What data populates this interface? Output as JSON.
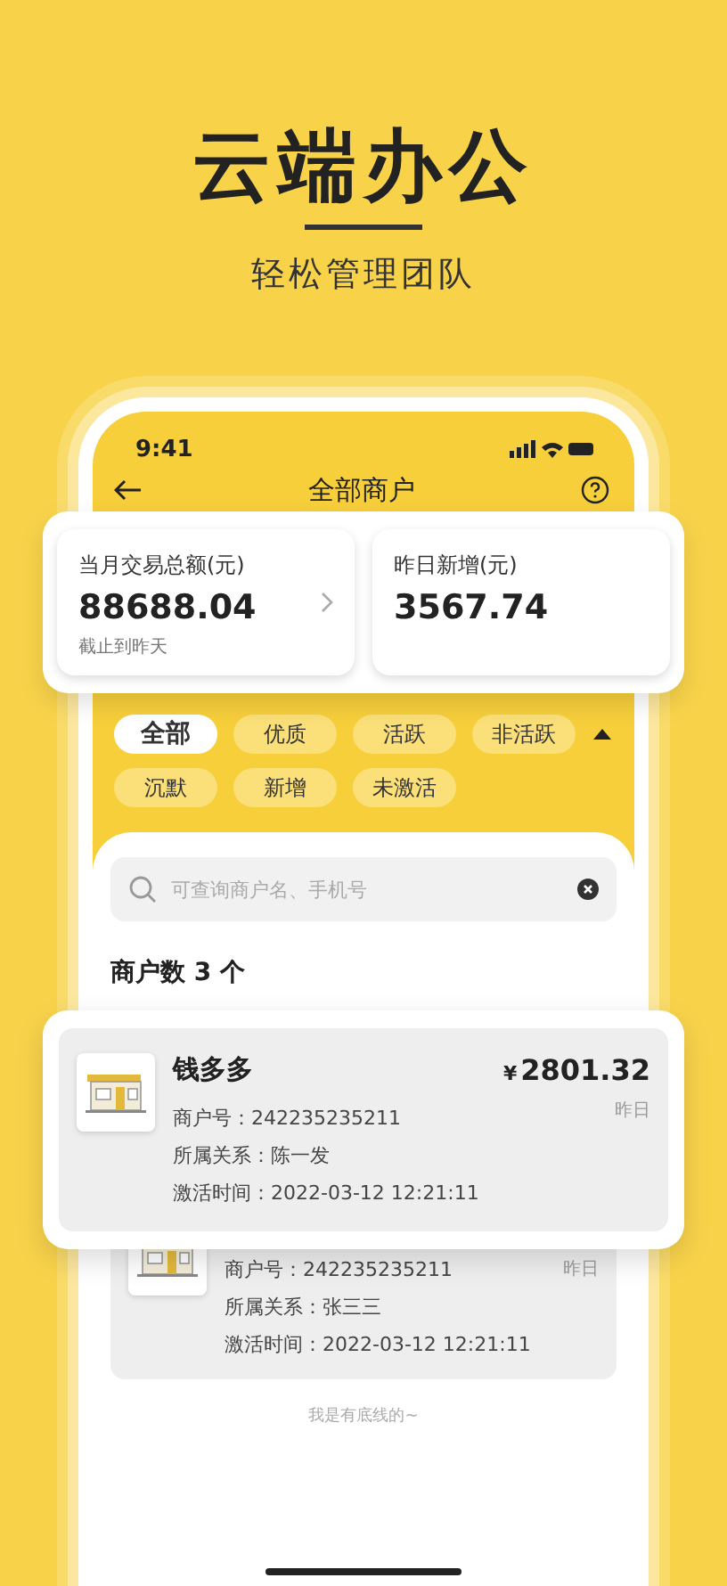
{
  "headline": "云端办公",
  "subtitle": "轻松管理团队",
  "status_bar": {
    "time": "9:41"
  },
  "nav": {
    "title": "全部商户"
  },
  "stats": [
    {
      "label": "当月交易总额(元)",
      "value": "88688.04",
      "note": "截止到昨天",
      "link": true
    },
    {
      "label": "昨日新增(元)",
      "value": "3567.74",
      "link": false
    }
  ],
  "filters": {
    "expanded": true,
    "rows": [
      [
        {
          "label": "全部",
          "selected": true
        },
        {
          "label": "优质",
          "selected": false
        },
        {
          "label": "活跃",
          "selected": false
        },
        {
          "label": "非活跃",
          "selected": false
        }
      ],
      [
        {
          "label": "沉默",
          "selected": false
        },
        {
          "label": "新增",
          "selected": false
        },
        {
          "label": "未激活",
          "selected": false
        }
      ]
    ]
  },
  "search": {
    "placeholder": "可查询商户名、手机号"
  },
  "count": "商户数 3 个",
  "merchants": [
    {
      "highlighted": true,
      "name": "钱多多",
      "amount": "2801.32",
      "currency": "¥",
      "when": "昨日",
      "lines": [
        "商户号：242235235211",
        "所属关系：陈一发",
        "激活时间：2022-03-12 12:21:11"
      ]
    },
    {
      "highlighted": false,
      "when": "昨日",
      "lines": [
        "商户号：242235235211",
        "所属关系：张三三",
        "激活时间：2022-03-12 12:21:11"
      ]
    }
  ],
  "footer": "我是有底线的~"
}
